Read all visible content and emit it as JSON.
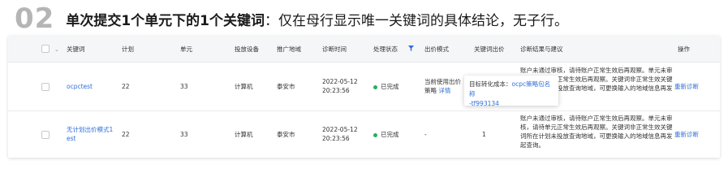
{
  "heading": {
    "number": "02",
    "bold": "单次提交1个单元下的1个关键词",
    "rest": "：仅在母行显示唯一关键词的具体结论，无子行。"
  },
  "columns": {
    "keyword": "关键词",
    "plan": "计划",
    "unit": "单元",
    "device": "投放设备",
    "region": "推广地域",
    "time": "诊断时间",
    "status": "处理状态",
    "bid_mode": "出价模式",
    "kw_bid": "关键词出价",
    "result": "诊断结果与建议",
    "action": "操作"
  },
  "rows": [
    {
      "keyword": "ocpctest",
      "plan": "22",
      "unit": "33",
      "device": "计算机",
      "region": "泰安市",
      "date": "2022-05-12",
      "time": "20:23:56",
      "status": "已完成",
      "bid_line1": "当前使用出价",
      "bid_line2": "策略",
      "bid_detail": "详情",
      "result": "账户未通过审核，请待账户正常生效后再观察。单元未审核，请待单元正常生效后再观察。关键词非正常生效关键词所在计划未投放查询地域，可更换输入的地域信息再发起查询。",
      "action": "重新诊断"
    },
    {
      "keyword_line1": "无计划出价模式1",
      "keyword_line2": "est",
      "plan": "22",
      "unit": "33",
      "device": "计算机",
      "region": "泰安市",
      "date": "2022-05-12",
      "time": "20:23:56",
      "status": "已完成",
      "bid_mode": "-",
      "kw_bid": "1",
      "result": "账户未通过审核，请待账户正常生效后再观察。单元未审核，请待单元正常生效后再观察。关键词非正常生效关键词所在计划未投放查询地域，可更换输入的地域信息再发起查询。",
      "action": "重新诊断"
    }
  ],
  "tooltip": {
    "line1_label": "目标转化成本：",
    "line1_value": "ocpc策略包名称",
    "line2": "-tf993134"
  },
  "colors": {
    "link": "#2e6fd9",
    "status_done": "#27ae60",
    "header_bg": "#f5f6f8"
  }
}
